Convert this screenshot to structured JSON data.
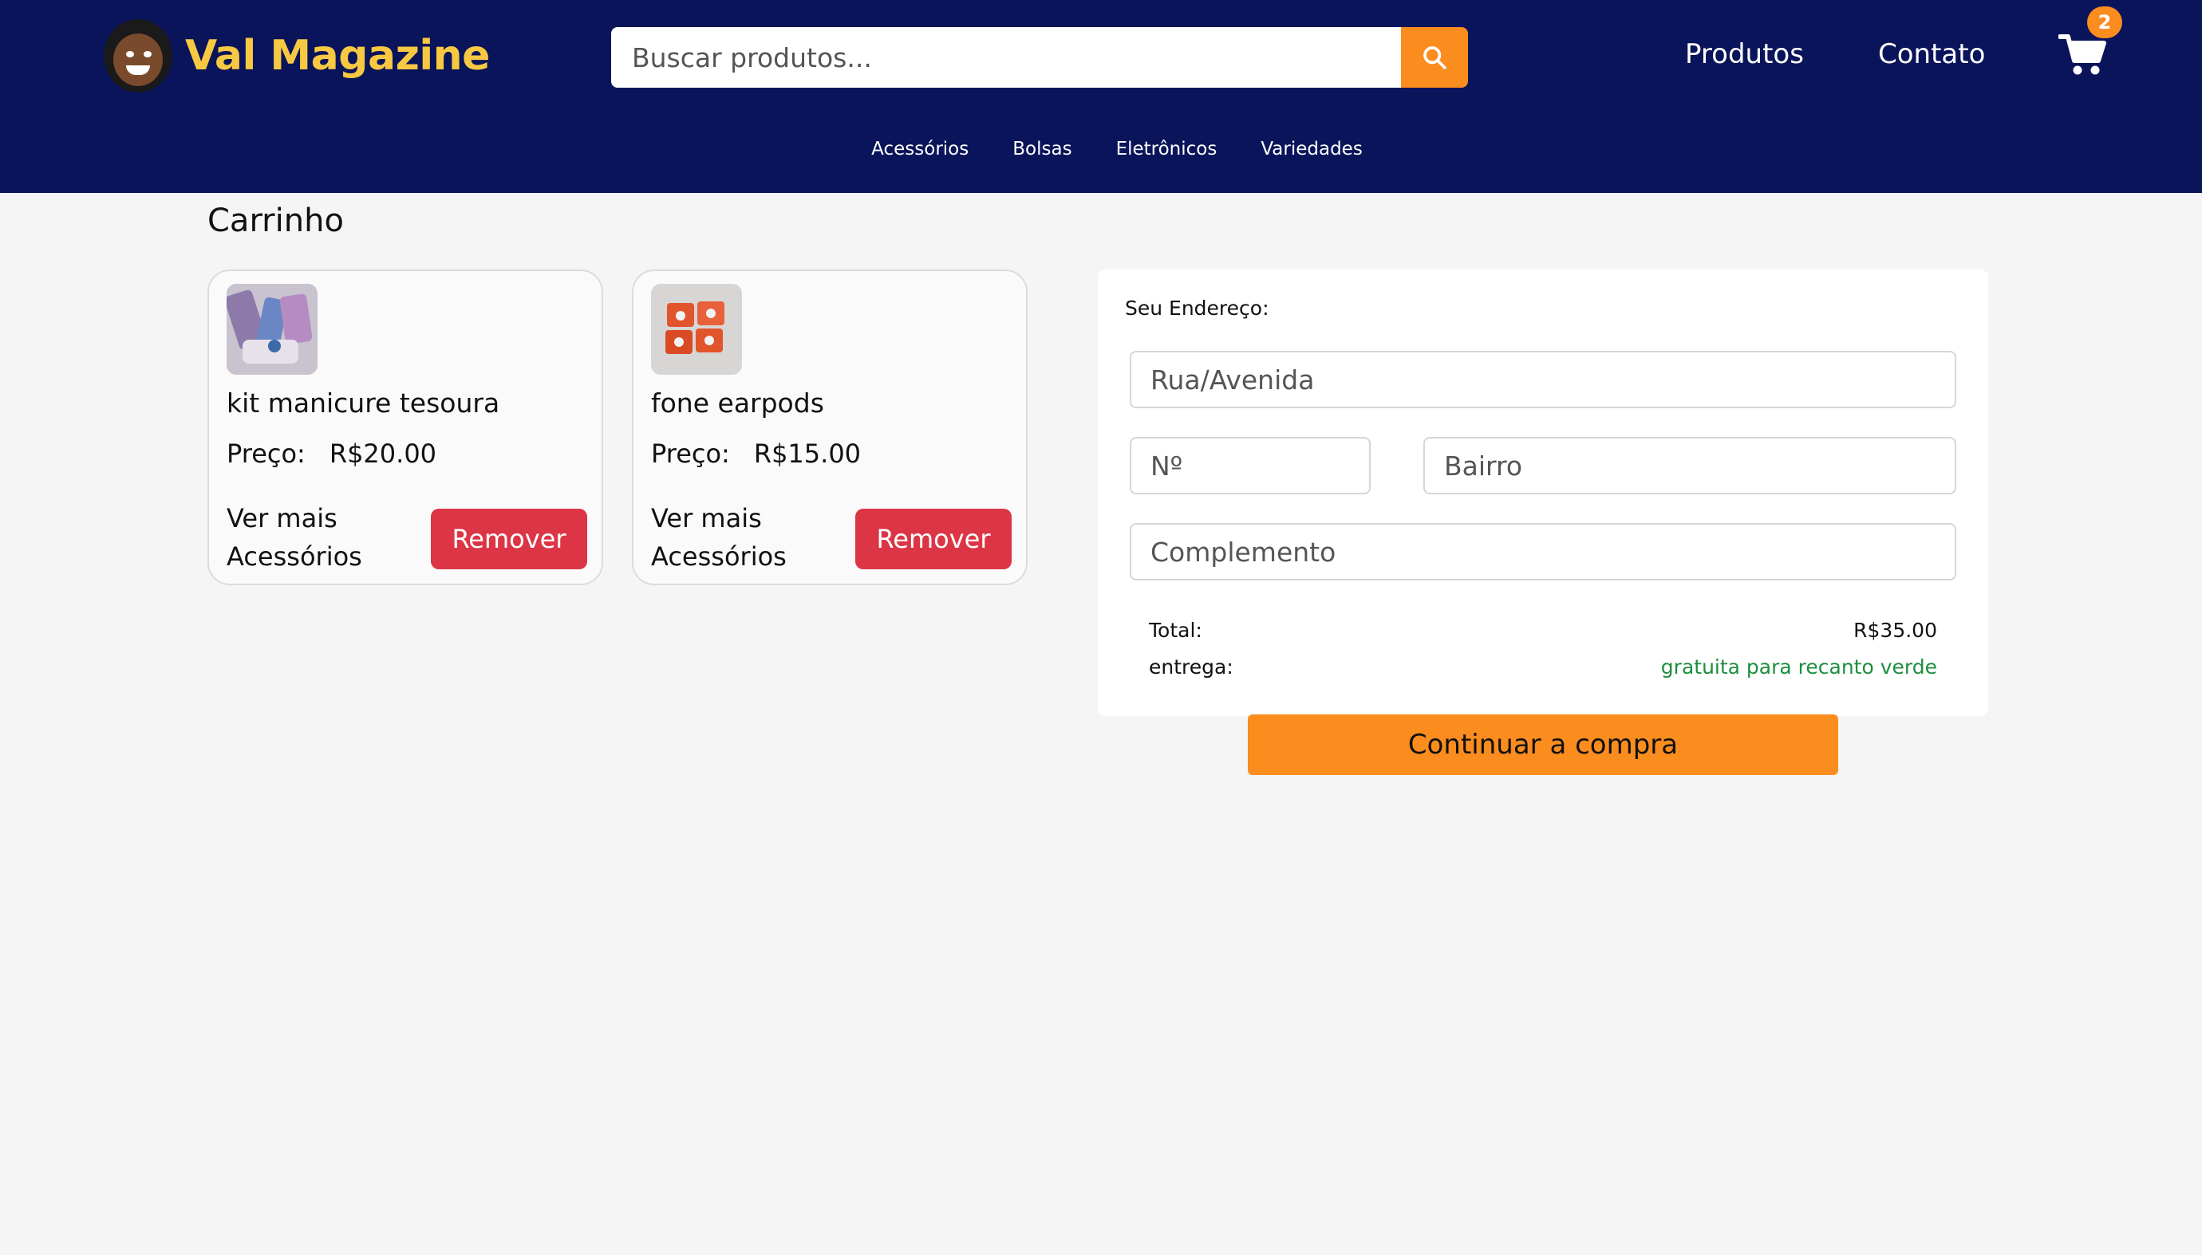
{
  "header": {
    "brand": "Val Magazine",
    "search_placeholder": "Buscar produtos...",
    "nav": [
      "Produtos",
      "Contato"
    ],
    "cart_count": "2",
    "categories": [
      "Acessórios",
      "Bolsas",
      "Eletrônicos",
      "Variedades"
    ]
  },
  "page": {
    "title": "Carrinho"
  },
  "cart_items": [
    {
      "name": "kit manicure tesoura",
      "price_label": "Preço:",
      "price": "R$20.00",
      "more_line1": "Ver mais",
      "more_line2": "Acessórios",
      "remove_label": "Remover"
    },
    {
      "name": "fone earpods",
      "price_label": "Preço:",
      "price": "R$15.00",
      "more_line1": "Ver mais",
      "more_line2": "Acessórios",
      "remove_label": "Remover"
    }
  ],
  "address": {
    "title": "Seu Endereço:",
    "street_placeholder": "Rua/Avenida",
    "number_placeholder": "Nº",
    "district_placeholder": "Bairro",
    "complement_placeholder": "Complemento",
    "total_label": "Total:",
    "total_value": "R$35.00",
    "delivery_label": "entrega:",
    "delivery_value": "gratuita para recanto verde",
    "delivery_color": "#1e8e3e"
  },
  "actions": {
    "continue_label": "Continuar a compra"
  },
  "colors": {
    "header_bg": "#0a145a",
    "brand": "#f7c942",
    "accent": "#fb8c1e",
    "danger": "#dc3545"
  }
}
